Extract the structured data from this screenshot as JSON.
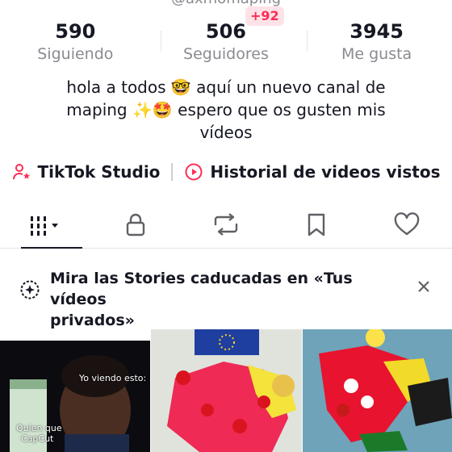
{
  "profile": {
    "handle": "@axmomaping",
    "stats": {
      "following": {
        "value": "590",
        "label": "Siguiendo"
      },
      "followers": {
        "value": "506",
        "label": "Seguidores",
        "badge": "+92"
      },
      "likes": {
        "value": "3945",
        "label": "Me gusta"
      }
    },
    "bio": {
      "line1": "hola a todos 🤓 aquí un nuevo canal de",
      "line2": "maping ✨🤩 espero que os gusten mis",
      "line3": "vídeos"
    }
  },
  "links": {
    "studio": "TikTok Studio",
    "history": "Historial de videos vistos"
  },
  "tabs": [
    {
      "name": "videos",
      "icon": "grid-icon",
      "active": true
    },
    {
      "name": "private",
      "icon": "lock-icon"
    },
    {
      "name": "reposts",
      "icon": "repost-icon"
    },
    {
      "name": "saved",
      "icon": "bookmark-icon"
    },
    {
      "name": "liked",
      "icon": "heart-icon"
    }
  ],
  "notice": {
    "line1": "Mira las Stories caducadas en «Tus vídeos",
    "line2": "privados»"
  },
  "videos": [
    {
      "captions": [
        "Yo viendo esto:",
        "Quien que",
        "CapCut"
      ]
    },
    {
      "captions": []
    },
    {
      "captions": []
    }
  ],
  "colors": {
    "accent": "#fe2c55",
    "text": "#161823",
    "muted": "#8a8b91"
  }
}
